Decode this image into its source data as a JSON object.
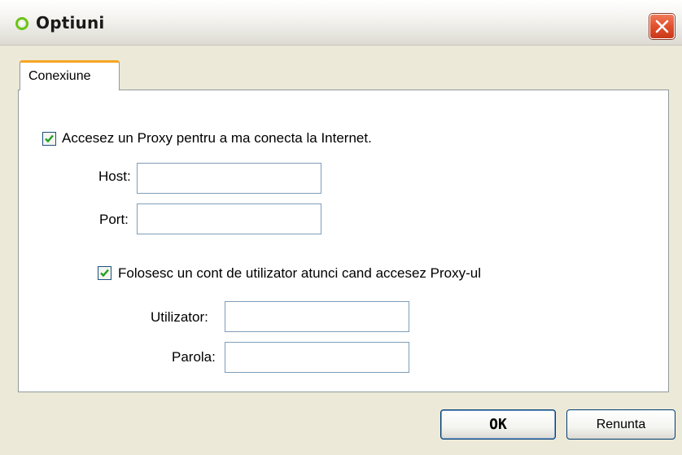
{
  "window": {
    "title": "Optiuni",
    "icon": "app-ring-icon",
    "close_icon": "close-icon"
  },
  "tabs": [
    {
      "label": "Conexiune",
      "selected": true
    }
  ],
  "proxy": {
    "use_proxy_label": "Accesez un Proxy pentru a ma conecta la Internet.",
    "use_proxy_checked": true,
    "host_label": "Host:",
    "host_value": "",
    "port_label": "Port:",
    "port_value": "",
    "use_account_label": "Folosesc un cont de utilizator atunci cand accesez Proxy-ul",
    "use_account_checked": true,
    "user_label": "Utilizator:",
    "user_value": "",
    "password_label": "Parola:",
    "password_value": ""
  },
  "buttons": {
    "ok_label": "OK",
    "cancel_label": "Renunta"
  },
  "colors": {
    "tab_accent": "#f5a623",
    "check": "#21a121",
    "close_button": "#e2502c"
  }
}
